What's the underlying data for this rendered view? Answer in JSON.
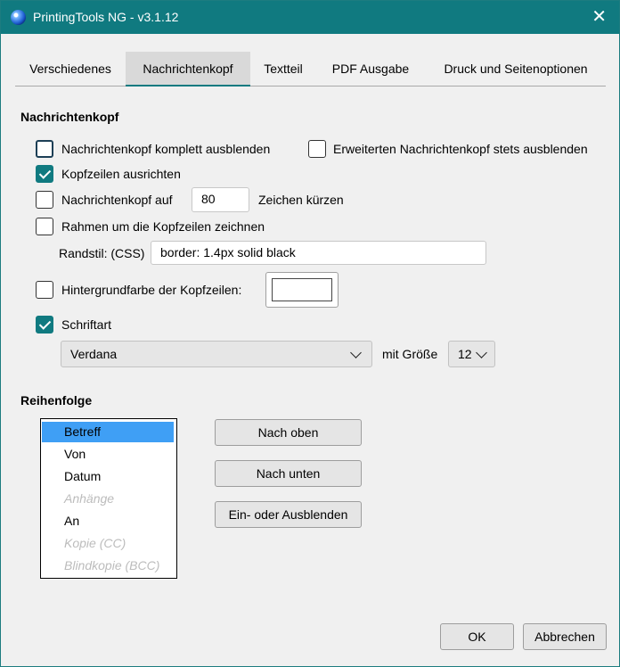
{
  "window": {
    "title": "PrintingTools NG - v3.1.12"
  },
  "tabs": [
    {
      "label": "Verschiedenes",
      "active": false
    },
    {
      "label": "Nachrichtenkopf",
      "active": true
    },
    {
      "label": "Textteil",
      "active": false
    },
    {
      "label": "PDF Ausgabe",
      "active": false
    },
    {
      "label": "Druck und Seitenoptionen",
      "active": false
    }
  ],
  "header_section": {
    "title": "Nachrichtenkopf",
    "hide_all": {
      "label": "Nachrichtenkopf komplett ausblenden",
      "checked": false
    },
    "hide_extended": {
      "label": "Erweiterten Nachrichtenkopf stets ausblenden",
      "checked": false
    },
    "align_lines": {
      "label": "Kopfzeilen ausrichten",
      "checked": true
    },
    "truncate": {
      "label_before": "Nachrichtenkopf auf",
      "value": "80",
      "label_after": "Zeichen kürzen",
      "checked": false
    },
    "border": {
      "label": "Rahmen um die Kopfzeilen zeichnen",
      "checked": false
    },
    "border_style": {
      "label": "Randstil: (CSS)",
      "value": "border: 1.4px solid black"
    },
    "background": {
      "label": "Hintergrundfarbe der Kopfzeilen:",
      "checked": false,
      "color": "#ffffff"
    },
    "font": {
      "label": "Schriftart",
      "checked": true,
      "family": "Verdana",
      "size_label": "mit Größe",
      "size": "12"
    }
  },
  "order_section": {
    "title": "Reihenfolge",
    "items": [
      {
        "label": "Betreff",
        "selected": true,
        "enabled": true
      },
      {
        "label": "Von",
        "selected": false,
        "enabled": true
      },
      {
        "label": "Datum",
        "selected": false,
        "enabled": true
      },
      {
        "label": "Anhänge",
        "selected": false,
        "enabled": false
      },
      {
        "label": "An",
        "selected": false,
        "enabled": true
      },
      {
        "label": "Kopie (CC)",
        "selected": false,
        "enabled": false
      },
      {
        "label": "Blindkopie (BCC)",
        "selected": false,
        "enabled": false
      }
    ],
    "buttons": {
      "up": "Nach oben",
      "down": "Nach unten",
      "toggle": "Ein- oder Ausblenden"
    }
  },
  "footer": {
    "ok": "OK",
    "cancel": "Abbrechen"
  },
  "colors": {
    "accent": "#107a80",
    "selection": "#3f9ff5"
  }
}
